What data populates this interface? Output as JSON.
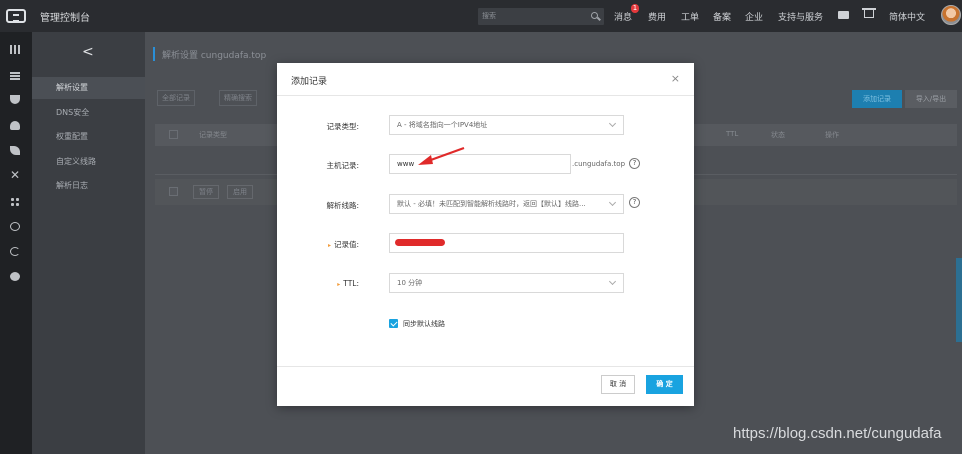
{
  "topbar": {
    "brand": "管理控制台",
    "search_placeholder": "搜索",
    "nav": [
      "消息",
      "费用",
      "工单",
      "备案",
      "企业",
      "支持与服务"
    ],
    "message_badge": "1",
    "language": "简体中文"
  },
  "icons": {
    "rail": [
      "grid-icon",
      "menu-icon",
      "shield-icon",
      "cloud-icon",
      "leaf-icon",
      "close-icon",
      "nodes-icon",
      "globe-icon",
      "pie-icon",
      "dot-icon"
    ],
    "topbar": [
      "logo-icon",
      "search-icon",
      "mail-icon",
      "cart-icon",
      "avatar"
    ]
  },
  "sidebar": {
    "back": "<",
    "items": [
      {
        "label": "解析设置",
        "active": true
      },
      {
        "label": "DNS安全",
        "active": false
      },
      {
        "label": "权重配置",
        "active": false
      },
      {
        "label": "自定义线路",
        "active": false
      },
      {
        "label": "解析日志",
        "active": false
      }
    ]
  },
  "main": {
    "breadcrumb": "解析设置 cungudafa.top",
    "filter_all": "全部记录",
    "filter_precise": "精确搜索",
    "add_record_button": "添加记录",
    "import_export_button": "导入/导出",
    "table_headers": [
      "记录类型",
      "TTL",
      "状态",
      "操作"
    ],
    "footer_buttons": [
      "暂停",
      "启用"
    ]
  },
  "modal": {
    "title": "添加记录",
    "close": "×",
    "record_type": {
      "label": "记录类型:",
      "value": "A - 将域名指向一个IPV4地址"
    },
    "host": {
      "label": "主机记录:",
      "value": "www",
      "suffix": ".cungudafa.top"
    },
    "line": {
      "label": "解析线路:",
      "value": "默认 - 必填！未匹配到智能解析线路时，返回【默认】线路..."
    },
    "record_value": {
      "label": "记录值:",
      "value": ""
    },
    "ttl": {
      "label": "TTL:",
      "value": "10 分钟"
    },
    "sync_default": {
      "label": "同步默认线路",
      "checked": true
    },
    "cancel": "取 消",
    "confirm": "确 定",
    "help_glyph": "?"
  },
  "colors": {
    "accent": "#19a3e0",
    "annotation": "#e02a2a",
    "required": "#f29b39"
  },
  "watermark": "https://blog.csdn.net/cungudafa"
}
